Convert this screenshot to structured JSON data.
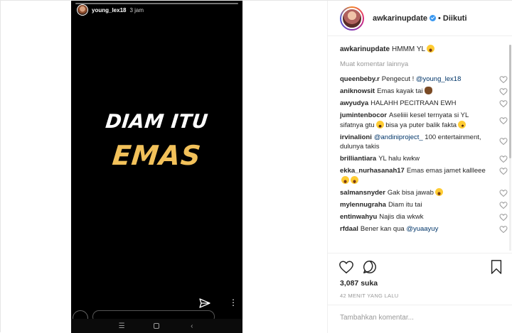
{
  "story": {
    "username": "young_lex18",
    "time": "3 jam",
    "line1": "DIAM ITU",
    "line2": "EMAS"
  },
  "post": {
    "username": "awkarinupdate",
    "dot": "•",
    "follow_label": "Diikuti",
    "caption_text": "HMMM YL",
    "load_more": "Muat komentar lainnya",
    "comments": [
      {
        "user": "queenbeby.r",
        "text": "Pengecut ! ",
        "mention": "@young_lex18"
      },
      {
        "user": "aniknowsit",
        "text": "Emas kayak tai",
        "emoji": "poop"
      },
      {
        "user": "awyudya",
        "text": "HALAHH PECITRAAN EWH"
      },
      {
        "user": "jumintenbocor",
        "text": "Aseliiii kesel ternyata si YL sifatnya gtu",
        "emoji": "tired",
        "text2": " bisa ya puter balik fakta",
        "emoji2": "smirk"
      },
      {
        "user": "irvinalioni",
        "text": "",
        "mention": "@andiniproject_",
        "text_after": " 100 entertainment, dulunya takis"
      },
      {
        "user": "brilliantiara",
        "text": "YL halu kwkw"
      },
      {
        "user": "ekka_nurhasanah17",
        "text": "Emas emas jamet kallleee",
        "emoji": "laugh",
        "emoji2": "laugh"
      },
      {
        "user": "salmansnyder",
        "text": "Gak bisa jawab",
        "emoji": "laugh"
      },
      {
        "user": "mylennugraha",
        "text": "Diam itu tai"
      },
      {
        "user": "entinwahyu",
        "text": "Najis dia wkwk"
      },
      {
        "user": "rfdaal",
        "text": "Bener kan qua ",
        "mention": "@yuaayuy"
      }
    ],
    "likes": "3,087 suka",
    "timestamp": "42 MENIT YANG LALU",
    "comment_placeholder": "Tambahkan komentar..."
  }
}
